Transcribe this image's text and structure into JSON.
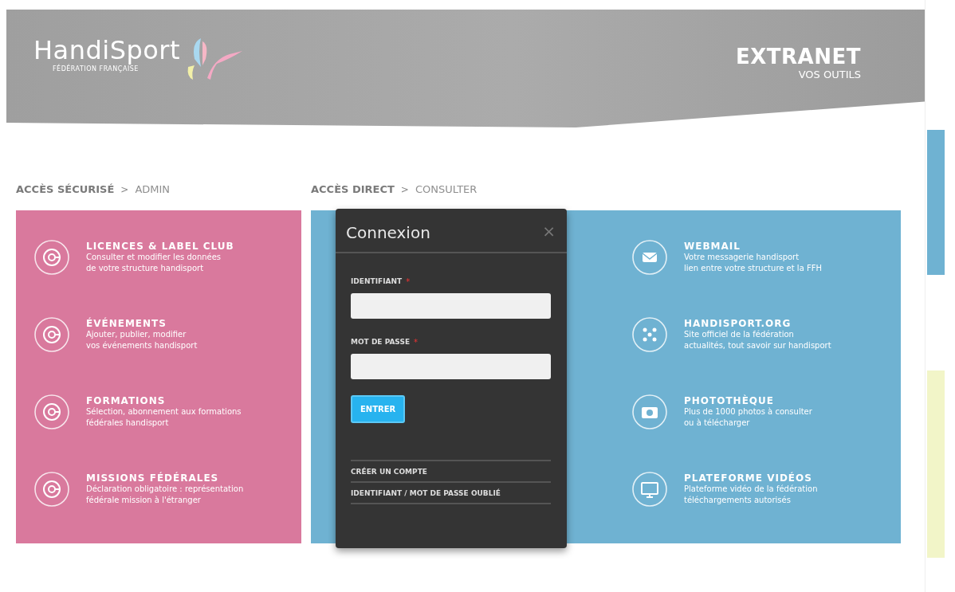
{
  "header": {
    "logo": "HandiSport",
    "logo_tagline": "FÉDÉRATION FRANÇAISE",
    "title": "EXTRANET",
    "subtitle": "VOS OUTILS"
  },
  "sections": [
    {
      "heading": "ACCÈS SÉCURISÉ",
      "separator": ">",
      "subheading": "ADMIN",
      "color": "#d9799d",
      "items": [
        {
          "title": "LICENCES & LABEL CLUB",
          "lines": [
            "Consulter et modifier les données",
            "de votre structure handisport"
          ]
        },
        {
          "title": "ÉVÉNEMENTS",
          "lines": [
            "Ajouter, publier, modifier",
            "vos événements handisport"
          ]
        },
        {
          "title": "FORMATIONS",
          "lines": [
            "Sélection, abonnement aux formations",
            "fédérales handisport"
          ]
        },
        {
          "title": "MISSIONS FÉDÉRALES",
          "lines": [
            "Déclaration obligatoire : représentation",
            "fédérale mission à l'étranger"
          ]
        }
      ]
    },
    {
      "heading": "ACCÈS DIRECT",
      "separator": ">",
      "subheading": "CONSULTER",
      "color": "#6fb2d2",
      "items": [
        {
          "title": "WEBMAIL",
          "lines": [
            "Votre messagerie handisport",
            "lien entre votre structure et la FFH"
          ]
        },
        {
          "title": "HANDISPORT.ORG",
          "lines": [
            "Site officiel de la fédération",
            "actualités, tout savoir sur handisport"
          ]
        },
        {
          "title": "PHOTOTHÈQUE",
          "lines": [
            "Plus de 1000 photos à consulter",
            "ou à télécharger"
          ]
        },
        {
          "title": "PLATEFORME VIDÉOS",
          "lines": [
            "Plateforme vidéo de la fédération",
            "téléchargements autorisés"
          ]
        }
      ]
    }
  ],
  "modal": {
    "title": "Connexion",
    "close": "×",
    "fields": [
      {
        "label": "IDENTIFIANT",
        "required": true
      },
      {
        "label": "MOT DE PASSE",
        "required": true
      }
    ],
    "required_mark": "*",
    "button": "ENTRER",
    "links": [
      "CRÉER UN COMPTE",
      "IDENTIFIANT / MOT DE PASSE OUBLIÉ"
    ]
  }
}
